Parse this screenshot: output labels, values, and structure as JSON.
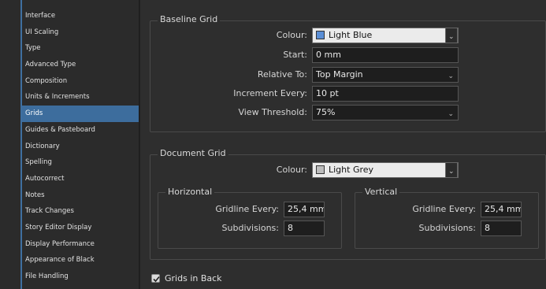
{
  "sidebar": {
    "items": [
      {
        "label": "Interface"
      },
      {
        "label": "UI Scaling"
      },
      {
        "label": "Type"
      },
      {
        "label": "Advanced Type"
      },
      {
        "label": "Composition"
      },
      {
        "label": "Units & Increments"
      },
      {
        "label": "Grids",
        "selected": true
      },
      {
        "label": "Guides & Pasteboard"
      },
      {
        "label": "Dictionary"
      },
      {
        "label": "Spelling"
      },
      {
        "label": "Autocorrect"
      },
      {
        "label": "Notes"
      },
      {
        "label": "Track Changes"
      },
      {
        "label": "Story Editor Display"
      },
      {
        "label": "Display Performance"
      },
      {
        "label": "Appearance of Black"
      },
      {
        "label": "File Handling"
      }
    ]
  },
  "baseline": {
    "title": "Baseline Grid",
    "colour_label": "Colour:",
    "colour_value": "Light Blue",
    "colour_swatch": "#5b8fd6",
    "start_label": "Start:",
    "start_value": "0 mm",
    "relative_label": "Relative To:",
    "relative_value": "Top Margin",
    "increment_label": "Increment Every:",
    "increment_value": "10 pt",
    "threshold_label": "View Threshold:",
    "threshold_value": "75%"
  },
  "document": {
    "title": "Document Grid",
    "colour_label": "Colour:",
    "colour_value": "Light Grey",
    "colour_swatch": "#bdbdbd",
    "horizontal": {
      "title": "Horizontal",
      "gridline_label": "Gridline Every:",
      "gridline_value": "25,4 mm",
      "subdivisions_label": "Subdivisions:",
      "subdivisions_value": "8"
    },
    "vertical": {
      "title": "Vertical",
      "gridline_label": "Gridline Every:",
      "gridline_value": "25,4 mm",
      "subdivisions_label": "Subdivisions:",
      "subdivisions_value": "8"
    }
  },
  "grids_in_back": {
    "label": "Grids in Back",
    "checked": true
  },
  "icons": {
    "chevron": "chevron-down-icon",
    "check": "checkmark-icon"
  }
}
